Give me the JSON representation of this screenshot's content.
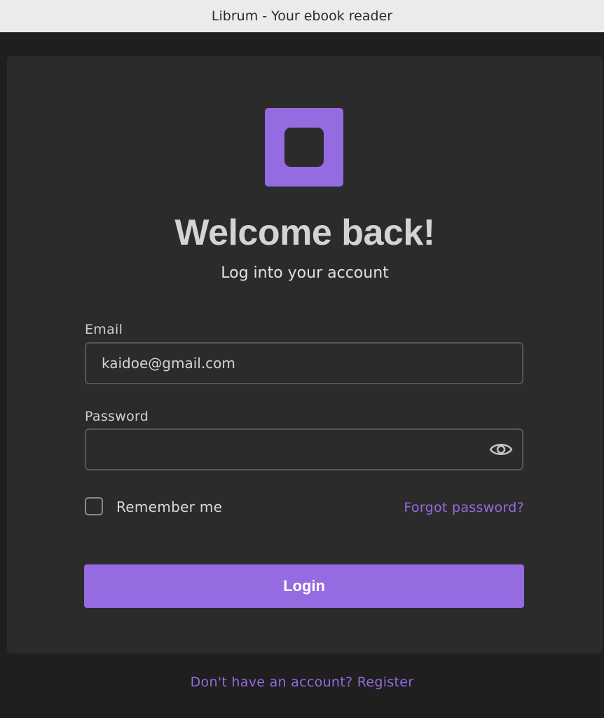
{
  "window": {
    "title": "Librum - Your ebook reader"
  },
  "logo": {
    "icon": "librum-logo-icon",
    "color": "#946be0"
  },
  "header": {
    "title": "Welcome back!",
    "subtitle": "Log into your account"
  },
  "form": {
    "email_label": "Email",
    "email_value": "kaidoe@gmail.com",
    "password_label": "Password",
    "password_value": "",
    "password_toggle_icon": "eye-icon",
    "remember_label": "Remember me",
    "remember_checked": false,
    "forgot_link": "Forgot password?",
    "login_label": "Login"
  },
  "footer": {
    "register_link": "Don't have an account? Register"
  },
  "colors": {
    "accent": "#946be0",
    "background": "#1f1f20",
    "card": "#2b2b2c"
  }
}
